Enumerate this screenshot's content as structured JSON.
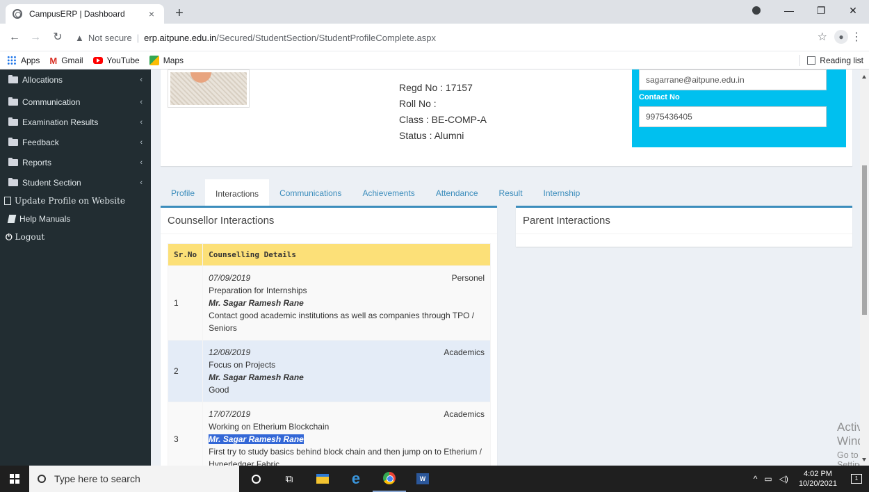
{
  "browser": {
    "tab_title": "CampusERP | Dashboard",
    "tab_close": "×",
    "new_tab": "+",
    "not_secure": "Not secure",
    "url_host": "erp.aitpune.edu.in",
    "url_path": "/Secured/StudentSection/StudentProfileComplete.aspx",
    "bookmarks": [
      "Apps",
      "Gmail",
      "YouTube",
      "Maps"
    ],
    "reading_list": "Reading list"
  },
  "sidebar": {
    "items": [
      {
        "label": "Allocations",
        "chevron": "‹"
      },
      {
        "label": "Communication",
        "chevron": "‹"
      },
      {
        "label": "Examination Results",
        "chevron": "‹"
      },
      {
        "label": "Feedback",
        "chevron": "‹"
      },
      {
        "label": "Reports",
        "chevron": "‹"
      },
      {
        "label": "Student Section",
        "chevron": "‹"
      }
    ],
    "update_profile": "Update Profile on Website",
    "help_manuals": "Help Manuals",
    "logout": "Logout"
  },
  "profile": {
    "regd": "Regd No : 17157",
    "roll": "Roll No :",
    "class": "Class : BE-COMP-A",
    "status": "Status : Alumni",
    "email": "sagarrane@aitpune.edu.in",
    "contact_label": "Contact No",
    "contact": "9975436405"
  },
  "tabs": [
    "Profile",
    "Interactions",
    "Communications",
    "Achievements",
    "Attendance",
    "Result",
    "Internship"
  ],
  "counsellor": {
    "title": "Counsellor Interactions",
    "headers": [
      "Sr.No",
      "Counselling Details"
    ],
    "rows": [
      {
        "sr": "1",
        "date": "07/09/2019",
        "category": "Personel",
        "topic": "Preparation for Internships",
        "counsellor": "Mr. Sagar Ramesh Rane",
        "remark": "Contact good academic institutions as well as companies through TPO / Seniors"
      },
      {
        "sr": "2",
        "date": "12/08/2019",
        "category": "Academics",
        "topic": "Focus on Projects",
        "counsellor": "Mr. Sagar Ramesh Rane",
        "remark": "Good"
      },
      {
        "sr": "3",
        "date": "17/07/2019",
        "category": "Academics",
        "topic": "Working on Etherium Blockchain",
        "counsellor": "Mr. Sagar Ramesh Rane",
        "remark": "First try to study basics behind block chain and then jump on to Etherium / Hyperledger Fabric"
      }
    ]
  },
  "parent": {
    "title": "Parent Interactions"
  },
  "watermark": {
    "line1": "Activate Windows",
    "line2": "Go to Settings to activate Windows."
  },
  "taskbar": {
    "search_placeholder": "Type here to search",
    "time": "4:02 PM",
    "date": "10/20/2021",
    "tray_icons": [
      "^",
      "▭",
      "◁)"
    ],
    "notification_count": "1"
  }
}
